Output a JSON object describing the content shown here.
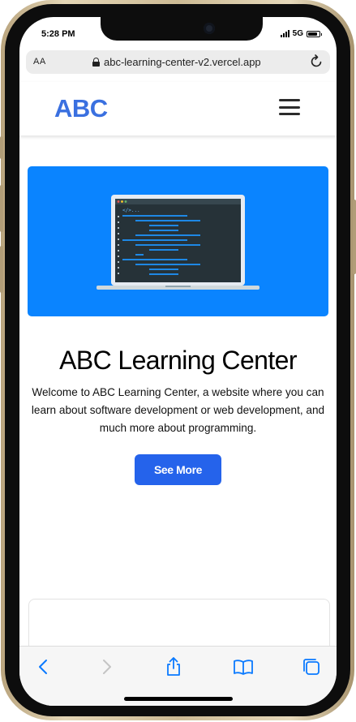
{
  "status_bar": {
    "time": "5:28 PM",
    "network": "5G",
    "battery_level": 0.85
  },
  "browser": {
    "aa_label": "AA",
    "url": "abc-learning-center-v2.vercel.app",
    "toolbar_icons": [
      "back-icon",
      "forward-icon",
      "share-icon",
      "bookmarks-icon",
      "tabs-icon"
    ]
  },
  "site": {
    "logo": "ABC",
    "hero_image": "laptop-code-illustration",
    "hero_code_tag": "</>...",
    "title": "ABC Learning Center",
    "description": "Welcome to ABC Learning Center, a website where you can learn about software development or web development, and much more about programming.",
    "cta_label": "See More"
  },
  "colors": {
    "brand_blue": "#3a70e0",
    "hero_blue": "#0a84ff",
    "button_blue": "#2563eb",
    "ios_blue": "#0a7aff"
  }
}
